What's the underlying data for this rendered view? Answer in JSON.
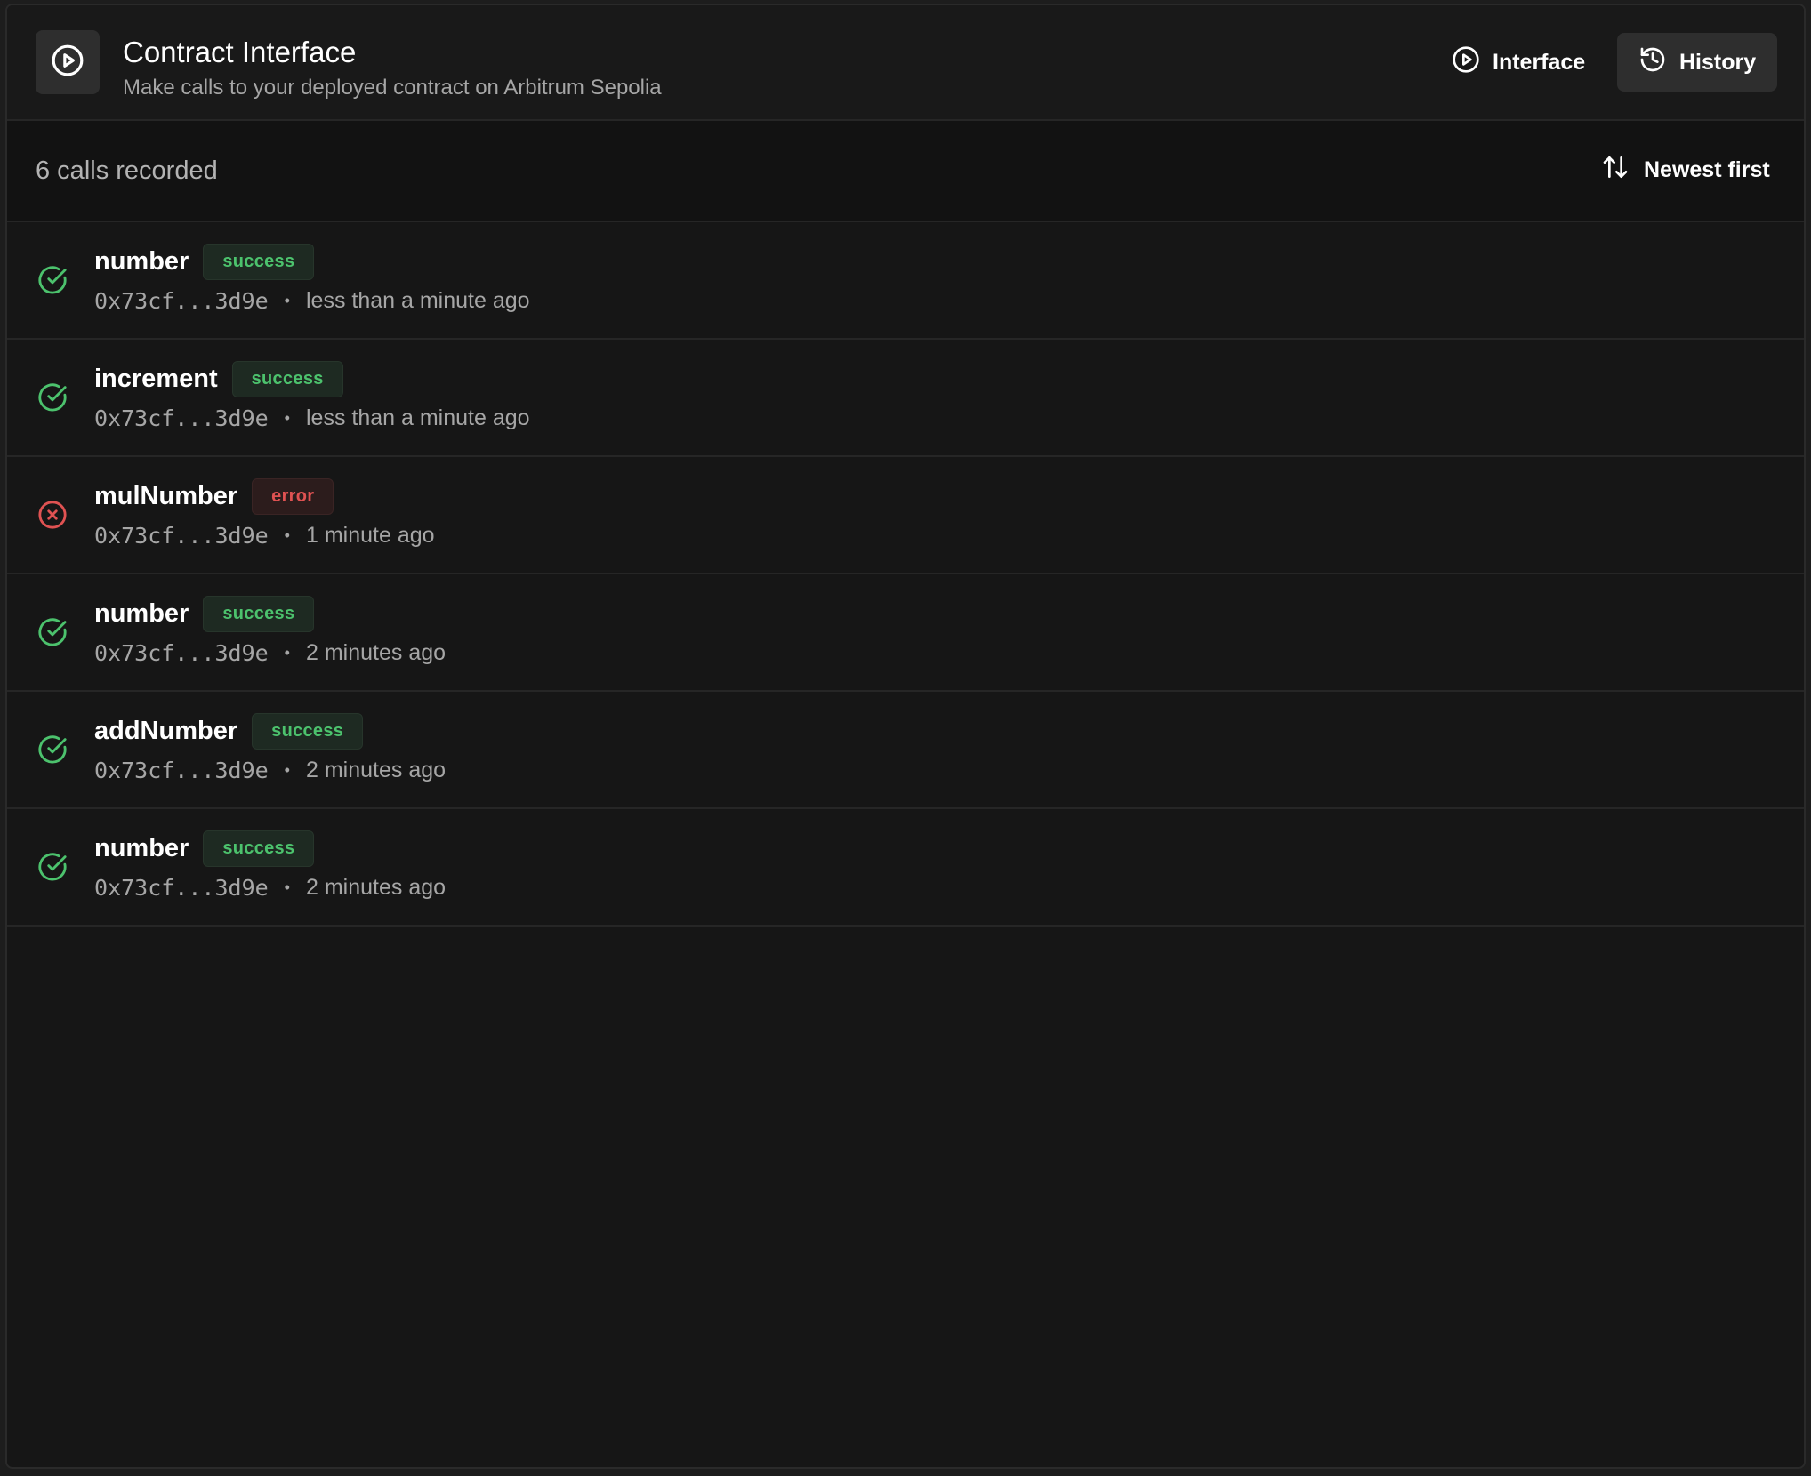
{
  "header": {
    "title": "Contract Interface",
    "subtitle": "Make calls to your deployed contract on Arbitrum Sepolia",
    "logo_icon": "play-circle-icon",
    "nav": [
      {
        "label": "Interface",
        "icon": "play-circle-icon",
        "active": false
      },
      {
        "label": "History",
        "icon": "history-icon",
        "active": true
      }
    ]
  },
  "toolbar": {
    "count_label": "6 calls recorded",
    "sort_label": "Newest first",
    "sort_icon": "sort-arrows-icon"
  },
  "calls": [
    {
      "name": "number",
      "status": "success",
      "address": "0x73cf...3d9e",
      "time": "less than a minute ago"
    },
    {
      "name": "increment",
      "status": "success",
      "address": "0x73cf...3d9e",
      "time": "less than a minute ago"
    },
    {
      "name": "mulNumber",
      "status": "error",
      "address": "0x73cf...3d9e",
      "time": "1 minute ago"
    },
    {
      "name": "number",
      "status": "success",
      "address": "0x73cf...3d9e",
      "time": "2 minutes ago"
    },
    {
      "name": "addNumber",
      "status": "success",
      "address": "0x73cf...3d9e",
      "time": "2 minutes ago"
    },
    {
      "name": "number",
      "status": "success",
      "address": "0x73cf...3d9e",
      "time": "2 minutes ago"
    }
  ],
  "colors": {
    "success": "#4cc26d",
    "error": "#e05252",
    "background": "#161616"
  }
}
